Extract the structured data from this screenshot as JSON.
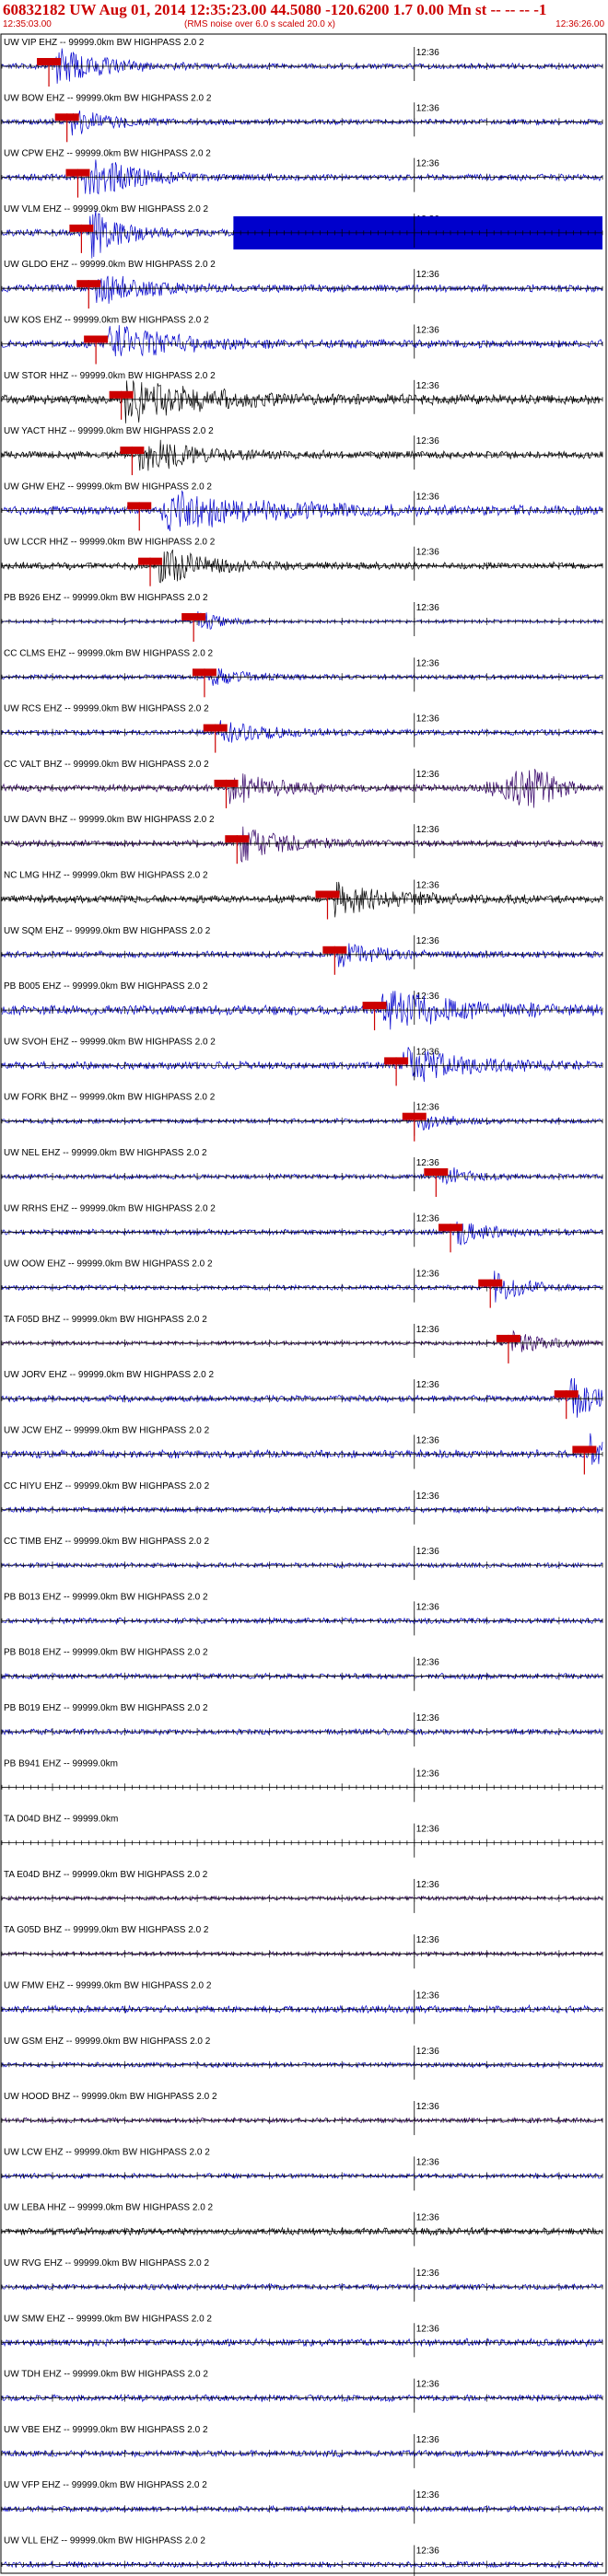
{
  "header": {
    "title": "60832182 UW Aug 01, 2014 12:35:23.00   44.5080 -120.6200  1.7 0.00 Mn st -- -- --  -1",
    "start_time": "12:35:03.00",
    "note": "(RMS noise over 6.0 s scaled 20.0 x)",
    "end_time": "12:36:26.00"
  },
  "chart_data": {
    "type": "line",
    "title": "60832182 UW Aug 01, 2014 12:35:23.00   44.5080 -120.6200  1.7 0.00 Mn st -- -- --  -1",
    "x_start": "12:35:03.00",
    "x_end": "12:36:26.00",
    "x_range_seconds": [
      0,
      83
    ],
    "minute_marker": {
      "label": "12:36",
      "t": 57
    },
    "traces": [
      {
        "label": "UW VIP EHZ -- 99999.0km BW HIGHPASS 2.0 2",
        "color": "#0000cc",
        "amp": 0.7,
        "pick": 6.5,
        "event": {
          "t": 7.5,
          "dur": 6,
          "amp": 3.5
        }
      },
      {
        "label": "UW BOW EHZ -- 99999.0km BW HIGHPASS 2.0 2",
        "color": "#0000cc",
        "amp": 0.7,
        "pick": 9.0,
        "event": {
          "t": 9.5,
          "dur": 5,
          "amp": 2.5
        }
      },
      {
        "label": "UW CPW EHZ -- 99999.0km BW HIGHPASS 2.0 2",
        "color": "#0000cc",
        "amp": 0.8,
        "pick": 10.5,
        "event": {
          "t": 11.5,
          "dur": 6,
          "amp": 4.0
        }
      },
      {
        "label": "UW VLM EHZ -- 99999.0km BW HIGHPASS 2.0 2",
        "color": "#0000cc",
        "amp": 0.9,
        "pick": 11.0,
        "event": {
          "t": 12.0,
          "dur": 4,
          "amp": 4.0
        },
        "block": {
          "t0": 32,
          "t1": 83
        }
      },
      {
        "label": "UW GLDO EHZ -- 99999.0km BW HIGHPASS 2.0 2",
        "color": "#0000cc",
        "amp": 0.9,
        "pick": 12.0,
        "event": {
          "t": 13.0,
          "dur": 6,
          "amp": 2.5
        }
      },
      {
        "label": "UW KOS EHZ -- 99999.0km BW HIGHPASS 2.0 2",
        "color": "#0000cc",
        "amp": 1.0,
        "pick": 13.0,
        "event": {
          "t": 14.5,
          "dur": 8,
          "amp": 2.8
        }
      },
      {
        "label": "UW STOR HHZ -- 99999.0km BW HIGHPASS 2.0 2",
        "color": "#000000",
        "amp": 1.2,
        "pick": 16.5,
        "event": {
          "t": 17.0,
          "dur": 10,
          "amp": 2.5
        }
      },
      {
        "label": "UW YACT HHZ -- 99999.0km BW HIGHPASS 2.0 2",
        "color": "#000000",
        "amp": 1.0,
        "pick": 18.0,
        "event": {
          "t": 19.0,
          "dur": 6,
          "amp": 2.5
        }
      },
      {
        "label": "UW GHW EHZ -- 99999.0km BW HIGHPASS 2.0 2",
        "color": "#0000cc",
        "amp": 1.1,
        "pick": 19.0,
        "event": {
          "t": 22.0,
          "dur": 14,
          "amp": 2.5
        }
      },
      {
        "label": "UW LCCR HHZ -- 99999.0km BW HIGHPASS 2.0 2",
        "color": "#000000",
        "amp": 0.9,
        "pick": 20.5,
        "event": {
          "t": 21.5,
          "dur": 6,
          "amp": 3.0
        }
      },
      {
        "label": "PB B926 EHZ -- 99999.0km BW HIGHPASS 2.0 2",
        "color": "#0000cc",
        "amp": 0.4,
        "pick": 26.5,
        "event": {
          "t": 27.0,
          "dur": 3,
          "amp": 4.0
        }
      },
      {
        "label": "CC CLMS EHZ -- 99999.0km BW HIGHPASS 2.0 2",
        "color": "#0000cc",
        "amp": 0.6,
        "pick": 28.0,
        "event": {
          "t": 28.5,
          "dur": 5,
          "amp": 2.0
        }
      },
      {
        "label": "UW RCS EHZ -- 99999.0km BW HIGHPASS 2.0 2",
        "color": "#0000cc",
        "amp": 0.7,
        "pick": 29.5,
        "event": {
          "t": 30.0,
          "dur": 6,
          "amp": 2.2
        }
      },
      {
        "label": "CC VALT BHZ -- 99999.0km BW HIGHPASS 2.0 2",
        "color": "#330066",
        "amp": 0.9,
        "pick": 31.0,
        "event": {
          "t": 31.5,
          "dur": 6,
          "amp": 2.5
        },
        "burst": {
          "t": 73,
          "dur": 10,
          "amp": 5.0
        }
      },
      {
        "label": "UW DAVN BHZ -- 99999.0km BW HIGHPASS 2.0 2",
        "color": "#330066",
        "amp": 0.8,
        "pick": 32.5,
        "event": {
          "t": 33.0,
          "dur": 6,
          "amp": 2.8
        }
      },
      {
        "label": "NC LMG HHZ -- 99999.0km BW HIGHPASS 2.0 2",
        "color": "#000000",
        "amp": 1.0,
        "pick": 45.0,
        "event": {
          "t": 46.0,
          "dur": 7,
          "amp": 2.2
        }
      },
      {
        "label": "UW SQM EHZ -- 99999.0km BW HIGHPASS 2.0 2",
        "color": "#0000cc",
        "amp": 0.8,
        "pick": 46.0,
        "event": {
          "t": 46.5,
          "dur": 6,
          "amp": 2.0
        }
      },
      {
        "label": "PB B005 EHZ -- 99999.0km BW HIGHPASS 2.0 2",
        "color": "#0000cc",
        "amp": 1.2,
        "pick": 51.5,
        "event": {
          "t": 52.5,
          "dur": 10,
          "amp": 2.2
        }
      },
      {
        "label": "UW SVOH EHZ -- 99999.0km BW HIGHPASS 2.0 2",
        "color": "#0000cc",
        "amp": 1.0,
        "pick": 54.5,
        "event": {
          "t": 55.5,
          "dur": 8,
          "amp": 2.3
        }
      },
      {
        "label": "UW FORK BHZ -- 99999.0km BW HIGHPASS 2.0 2",
        "color": "#0000cc",
        "amp": 0.6,
        "pick": 57.0,
        "event": {
          "t": 57.5,
          "dur": 4,
          "amp": 2.0
        }
      },
      {
        "label": "UW NEL EHZ -- 99999.0km BW HIGHPASS 2.0 2",
        "color": "#0000cc",
        "amp": 0.6,
        "pick": 60.0,
        "event": {
          "t": 60.5,
          "dur": 4,
          "amp": 2.5
        }
      },
      {
        "label": "UW RRHS EHZ -- 99999.0km BW HIGHPASS 2.0 2",
        "color": "#0000cc",
        "amp": 0.7,
        "pick": 62.0,
        "event": {
          "t": 62.5,
          "dur": 4,
          "amp": 3.0
        }
      },
      {
        "label": "UW OOW EHZ -- 99999.0km BW HIGHPASS 2.0 2",
        "color": "#0000cc",
        "amp": 0.6,
        "pick": 67.5,
        "event": {
          "t": 68.0,
          "dur": 4,
          "amp": 3.5
        }
      },
      {
        "label": "TA F05D BHZ -- 99999.0km BW HIGHPASS 2.0 2",
        "color": "#330066",
        "amp": 0.5,
        "pick": 70.0,
        "event": {
          "t": 70.5,
          "dur": 5,
          "amp": 3.0
        }
      },
      {
        "label": "UW JORV EHZ -- 99999.0km BW HIGHPASS 2.0 2",
        "color": "#0000cc",
        "amp": 0.8,
        "pick": 78.0,
        "event": {
          "t": 78.5,
          "dur": 4,
          "amp": 3.5
        }
      },
      {
        "label": "UW JCW EHZ -- 99999.0km BW HIGHPASS 2.0 2",
        "color": "#0000cc",
        "amp": 1.0,
        "pick": 80.5,
        "event": {
          "t": 81.0,
          "dur": 3,
          "amp": 3.0
        }
      },
      {
        "label": "CC HIYU EHZ -- 99999.0km BW HIGHPASS 2.0 2",
        "color": "#0000cc",
        "amp": 0.7
      },
      {
        "label": "CC TIMB EHZ -- 99999.0km BW HIGHPASS 2.0 2",
        "color": "#0000cc",
        "amp": 0.6
      },
      {
        "label": "PB B013 EHZ -- 99999.0km BW HIGHPASS 2.0 2",
        "color": "#0000cc",
        "amp": 0.7
      },
      {
        "label": "PB B018 EHZ -- 99999.0km BW HIGHPASS 2.0 2",
        "color": "#0000cc",
        "amp": 0.7
      },
      {
        "label": "PB B019 EHZ -- 99999.0km BW HIGHPASS 2.0 2",
        "color": "#0000cc",
        "amp": 0.7
      },
      {
        "label": "PB B941 EHZ -- 99999.0km",
        "color": "#0000cc",
        "amp": 0.0
      },
      {
        "label": "TA D04D BHZ -- 99999.0km",
        "color": "#330066",
        "amp": 0.0
      },
      {
        "label": "TA E04D BHZ -- 99999.0km BW HIGHPASS 2.0 2",
        "color": "#330066",
        "amp": 0.5
      },
      {
        "label": "TA G05D BHZ -- 99999.0km BW HIGHPASS 2.0 2",
        "color": "#330066",
        "amp": 0.5
      },
      {
        "label": "UW FMW EHZ -- 99999.0km BW HIGHPASS 2.0 2",
        "color": "#0000cc",
        "amp": 0.9
      },
      {
        "label": "UW GSM EHZ -- 99999.0km BW HIGHPASS 2.0 2",
        "color": "#0000cc",
        "amp": 0.6
      },
      {
        "label": "UW HOOD BHZ -- 99999.0km BW HIGHPASS 2.0 2",
        "color": "#330066",
        "amp": 0.6
      },
      {
        "label": "UW LCW EHZ -- 99999.0km BW HIGHPASS 2.0 2",
        "color": "#0000cc",
        "amp": 0.6
      },
      {
        "label": "UW LEBA HHZ -- 99999.0km BW HIGHPASS 2.0 2",
        "color": "#000000",
        "amp": 0.9
      },
      {
        "label": "UW RVG EHZ -- 99999.0km BW HIGHPASS 2.0 2",
        "color": "#0000cc",
        "amp": 0.7
      },
      {
        "label": "UW SMW EHZ -- 99999.0km BW HIGHPASS 2.0 2",
        "color": "#0000cc",
        "amp": 0.9
      },
      {
        "label": "UW TDH EHZ -- 99999.0km BW HIGHPASS 2.0 2",
        "color": "#0000cc",
        "amp": 0.8
      },
      {
        "label": "UW VBE EHZ -- 99999.0km BW HIGHPASS 2.0 2",
        "color": "#0000cc",
        "amp": 0.8
      },
      {
        "label": "UW VFP EHZ -- 99999.0km BW HIGHPASS 2.0 2",
        "color": "#0000cc",
        "amp": 0.7
      },
      {
        "label": "UW VLL EHZ -- 99999.0km BW HIGHPASS 2.0 2",
        "color": "#0000cc",
        "amp": 0.7
      }
    ]
  },
  "colors": {
    "header": "#cc0000",
    "pick": "#cc0000",
    "axis": "#000000"
  }
}
